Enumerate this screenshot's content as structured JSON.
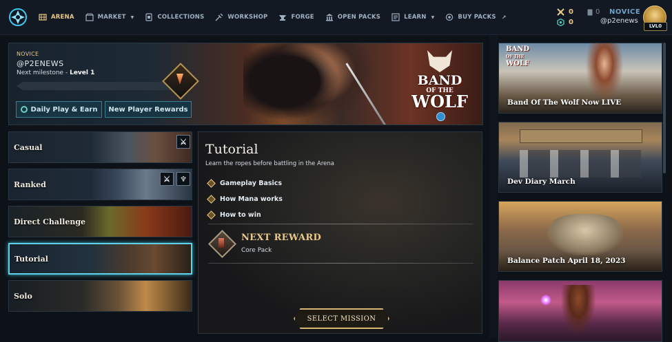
{
  "nav": {
    "items": [
      {
        "label": "ARENA",
        "icon": "arena-icon",
        "active": true,
        "dropdown": false
      },
      {
        "label": "MARKET",
        "icon": "market-icon",
        "active": false,
        "dropdown": true
      },
      {
        "label": "COLLECTIONS",
        "icon": "collections-icon",
        "active": false,
        "dropdown": false
      },
      {
        "label": "WORKSHOP",
        "icon": "workshop-icon",
        "active": false,
        "dropdown": false
      },
      {
        "label": "FORGE",
        "icon": "forge-icon",
        "active": false,
        "dropdown": false
      },
      {
        "label": "OPEN PACKS",
        "icon": "open-packs-icon",
        "active": false,
        "dropdown": false
      },
      {
        "label": "LEARN",
        "icon": "learn-icon",
        "active": false,
        "dropdown": true
      },
      {
        "label": "BUY PACKS",
        "icon": "buy-packs-icon",
        "active": false,
        "dropdown": false,
        "external": true
      }
    ]
  },
  "account": {
    "currency_gold": "0",
    "currency_blue": "0",
    "cards": "0",
    "rank": "NOVICE",
    "username": "@p2enews",
    "level_badge": "LVL0"
  },
  "hero": {
    "rank": "NOVICE",
    "username": "@P2ENEWS",
    "milestone_prefix": "Next milestone - ",
    "milestone_level": "Level 1",
    "progress_fraction": 0.0,
    "button_daily": "Daily Play & Earn",
    "button_new_player": "New Player Rewards",
    "promo_line1": "BAND",
    "promo_line2": "OF THE",
    "promo_line3": "WOLF"
  },
  "modes": [
    {
      "label": "Casual",
      "selected": false,
      "badges": [
        "crossed-swords-icon"
      ]
    },
    {
      "label": "Ranked",
      "selected": false,
      "badges": [
        "crossed-swords-icon",
        "claw-icon"
      ]
    },
    {
      "label": "Direct Challenge",
      "selected": false,
      "badges": []
    },
    {
      "label": "Tutorial",
      "selected": true,
      "badges": []
    },
    {
      "label": "Solo",
      "selected": false,
      "badges": []
    }
  ],
  "tutorial": {
    "title": "Tutorial",
    "subtitle": "Learn the ropes before battling in the Arena",
    "bullets": [
      "Gameplay Basics",
      "How Mana works",
      "How to win"
    ],
    "reward_title": "NEXT REWARD",
    "reward_item": "Core Pack",
    "select_button": "SELECT MISSION"
  },
  "news": [
    {
      "label": "Band Of The Wolf Now LIVE",
      "logo_line1": "BAND",
      "logo_line2": "OF THE",
      "logo_line3": "WOLF"
    },
    {
      "label": "Dev Diary March"
    },
    {
      "label": "Balance Patch April 18, 2023"
    },
    {
      "label": ""
    }
  ],
  "colors": {
    "accent_gold": "#e9c98a",
    "accent_cyan": "#5fd0e6",
    "background": "#0d1218"
  }
}
